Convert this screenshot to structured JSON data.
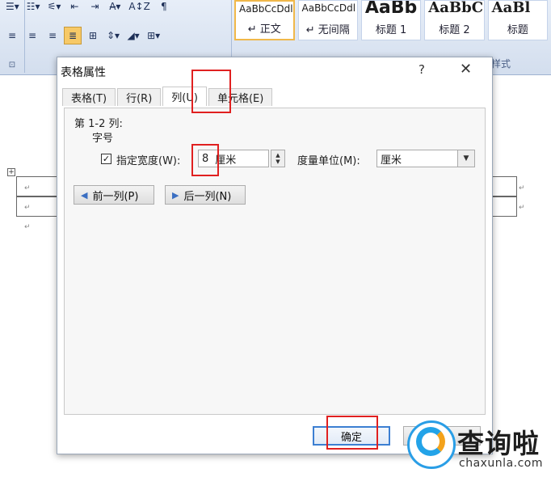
{
  "ribbon": {
    "buttons_row1": [
      "☰▾",
      "☷▾",
      "⚟▾",
      "⇤",
      "⇥",
      "A̶▾",
      "A↕Z",
      "¶"
    ],
    "buttons_row2": [
      "≡",
      "≡",
      "≡",
      "≣",
      "⊞",
      "⇕▾",
      "◢▾",
      "⊞▾"
    ],
    "styles": [
      {
        "sample": "AaBbCcDdl",
        "name": "↵ 正文",
        "active": true,
        "size": "normal"
      },
      {
        "sample": "AaBbCcDdl",
        "name": "↵ 无间隔",
        "active": false,
        "size": "normal"
      },
      {
        "sample": "AaBb",
        "name": "标题 1",
        "active": false,
        "size": "big"
      },
      {
        "sample": "AaBbC",
        "name": "标题 2",
        "active": false,
        "size": "mid"
      },
      {
        "sample": "AaBl",
        "name": "标题",
        "active": false,
        "size": "mid"
      }
    ],
    "group_label_right": "样式",
    "left_caption": "⊡"
  },
  "dialog": {
    "title": "表格属性",
    "help": "?",
    "close": "✕",
    "tabs": [
      {
        "label": "表格(T)",
        "active": false
      },
      {
        "label": "行(R)",
        "active": false
      },
      {
        "label": "列(U)",
        "active": true
      },
      {
        "label": "单元格(E)",
        "active": false
      }
    ],
    "column_range": "第 1-2 列:",
    "section_label": "字号",
    "specify_width_label": "指定宽度(W):",
    "specify_width_checked": "✓",
    "width_value": "8",
    "width_unit_text": "厘米",
    "measure_unit_label": "度量单位(M):",
    "measure_unit_value": "厘米",
    "prev_column": "前一列(P)",
    "next_column": "后一列(N)",
    "ok": "确定"
  },
  "document": {
    "paragraph_mark": "↵",
    "table_handle": "+"
  },
  "watermark": {
    "brand_cn": "查询啦",
    "brand_en": "chaxunla.com"
  },
  "colors": {
    "highlight_red": "#e02020",
    "ok_border": "#3c7fd2",
    "ribbon_bg": "#d3deee"
  }
}
